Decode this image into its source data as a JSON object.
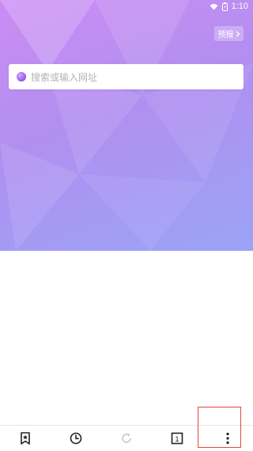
{
  "status_bar": {
    "time": "1:10"
  },
  "hero": {
    "forecast_label": "预报",
    "search_placeholder": "搜索或输入网址"
  },
  "toolbar": {
    "items": [
      {
        "icon": "bookmark-star-icon"
      },
      {
        "icon": "history-clock-icon"
      },
      {
        "icon": "refresh-icon",
        "state": "disabled"
      },
      {
        "icon": "tab-count-icon",
        "count": "1"
      },
      {
        "icon": "more-vertical-icon"
      }
    ]
  },
  "colors": {
    "gradient_start": "#cc8cf4",
    "gradient_end": "#9aa4f6",
    "highlight_box": "#e2473f"
  }
}
